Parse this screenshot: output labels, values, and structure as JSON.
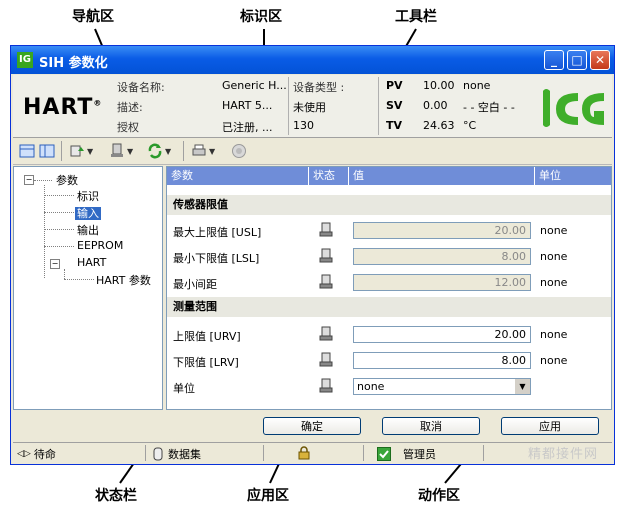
{
  "callouts": {
    "nav": "导航区",
    "ident": "标识区",
    "toolbar": "工具栏",
    "status": "状态栏",
    "app": "应用区",
    "action": "动作区"
  },
  "window": {
    "title": "SIH 参数化",
    "logo_text": "ICG",
    "minimize": "_",
    "maximize": "□",
    "close": "✕"
  },
  "header": {
    "hart_logo": "HART",
    "device_name_label": "设备名称:",
    "device_name_value": "Generic H...",
    "desc_label": "描述:",
    "desc_value": "HART 5...",
    "auth_label": "授权",
    "auth_value": "已注册, ...",
    "type_label": "设备类型 :",
    "type_value1": "未使用",
    "type_value2": "130",
    "pv_label": "PV",
    "pv_value": "10.00",
    "pv_unit": "none",
    "sv_label": "SV",
    "sv_value": "0.00",
    "sv_unit": "- - 空白 - -",
    "tv_label": "TV",
    "tv_value": "24.63",
    "tv_unit": "°C"
  },
  "toolbar": {
    "icons": [
      "layout-icon",
      "layout2-icon",
      "upload-icon",
      "device-icon",
      "refresh-icon",
      "print-icon",
      "help-icon"
    ]
  },
  "nav": {
    "root": "参数",
    "items": [
      "标识",
      "输入",
      "输出",
      "EEPROM",
      "HART",
      "HART 参数"
    ]
  },
  "table": {
    "headers": [
      "参数",
      "状态",
      "值",
      "单位"
    ],
    "section1": "传感器限值",
    "section2": "测量范围",
    "rows": [
      {
        "label": "最大上限值 [USL]",
        "value": "20.00",
        "unit": "none"
      },
      {
        "label": "最小下限值 [LSL]",
        "value": "8.00",
        "unit": "none"
      },
      {
        "label": "最小间距",
        "value": "12.00",
        "unit": "none"
      },
      {
        "label": "上限值 [URV]",
        "value": "20.00",
        "unit": "none"
      },
      {
        "label": "下限值 [LRV]",
        "value": "8.00",
        "unit": "none"
      },
      {
        "label": "单位",
        "value": "none",
        "unit": ""
      }
    ]
  },
  "actions": {
    "ok": "确定",
    "cancel": "取消",
    "apply": "应用"
  },
  "status": {
    "wait": "待命",
    "dataset": "数据集",
    "user": "管理员"
  },
  "watermark": "精都接件网"
}
